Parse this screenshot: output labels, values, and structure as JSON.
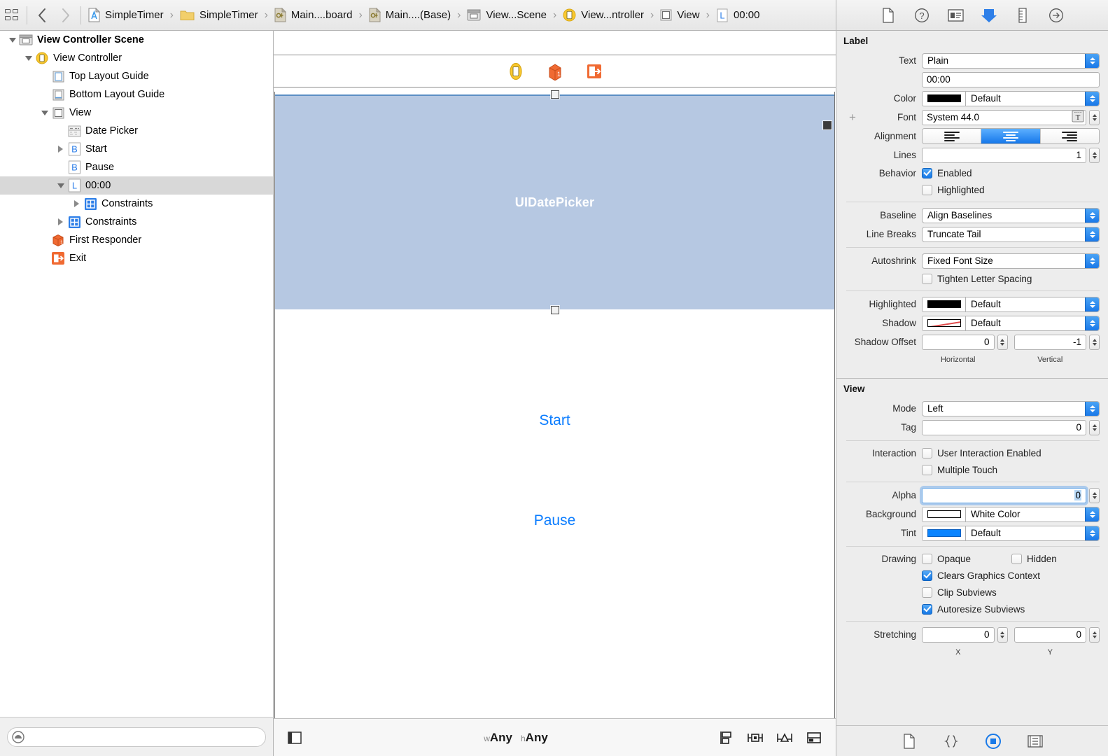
{
  "jumpbar": {
    "nav_back": "‹",
    "nav_forward": "›",
    "breadcrumbs": [
      {
        "label": "SimpleTimer",
        "icon": "project-icon"
      },
      {
        "label": "SimpleTimer",
        "icon": "folder-icon"
      },
      {
        "label": "Main....board",
        "icon": "storyboard-file-icon"
      },
      {
        "label": "Main....(Base)",
        "icon": "storyboard-file-icon"
      },
      {
        "label": "View...Scene",
        "icon": "scene-icon"
      },
      {
        "label": "View...ntroller",
        "icon": "view-controller-icon"
      },
      {
        "label": "View",
        "icon": "view-icon"
      },
      {
        "label": "00:00",
        "icon": "label-icon"
      }
    ],
    "separator": "›"
  },
  "inspector_toolbar": {
    "tabs": [
      {
        "name": "file-inspector",
        "icon": "document-icon",
        "selected": false
      },
      {
        "name": "quick-help-inspector",
        "icon": "question-circle-icon",
        "selected": false
      },
      {
        "name": "identity-inspector",
        "icon": "id-card-icon",
        "selected": false
      },
      {
        "name": "attributes-inspector",
        "icon": "down-arrow-shield-icon",
        "selected": true
      },
      {
        "name": "size-inspector",
        "icon": "ruler-icon",
        "selected": false
      },
      {
        "name": "connections-inspector",
        "icon": "arrow-right-circle-icon",
        "selected": false
      }
    ],
    "selected_color": "#2e7fe8"
  },
  "outline": {
    "rows": [
      {
        "label": "View Controller Scene",
        "indent": 0,
        "twisty": "down",
        "icon": "scene-icon",
        "bold": true,
        "selected": false
      },
      {
        "label": "View Controller",
        "indent": 1,
        "twisty": "down",
        "icon": "view-controller-icon",
        "bold": false,
        "selected": false
      },
      {
        "label": "Top Layout Guide",
        "indent": 2,
        "twisty": "none",
        "icon": "top-layout-guide-icon",
        "bold": false,
        "selected": false
      },
      {
        "label": "Bottom Layout Guide",
        "indent": 2,
        "twisty": "none",
        "icon": "bottom-layout-guide-icon",
        "bold": false,
        "selected": false
      },
      {
        "label": "View",
        "indent": 2,
        "twisty": "down",
        "icon": "view-icon",
        "bold": false,
        "selected": false
      },
      {
        "label": "Date Picker",
        "indent": 3,
        "twisty": "none",
        "icon": "date-picker-icon",
        "bold": false,
        "selected": false
      },
      {
        "label": "Start",
        "indent": 3,
        "twisty": "right",
        "icon": "button-icon",
        "bold": false,
        "selected": false
      },
      {
        "label": "Pause",
        "indent": 3,
        "twisty": "none",
        "icon": "button-icon",
        "bold": false,
        "selected": false
      },
      {
        "label": "00:00",
        "indent": 3,
        "twisty": "down",
        "icon": "label-icon",
        "bold": false,
        "selected": true
      },
      {
        "label": "Constraints",
        "indent": 4,
        "twisty": "right",
        "icon": "constraints-icon",
        "bold": false,
        "selected": false
      },
      {
        "label": "Constraints",
        "indent": 3,
        "twisty": "right",
        "icon": "constraints-icon",
        "bold": false,
        "selected": false
      },
      {
        "label": "First Responder",
        "indent": 2,
        "twisty": "none",
        "icon": "first-responder-icon",
        "bold": false,
        "selected": false
      },
      {
        "label": "Exit",
        "indent": 2,
        "twisty": "none",
        "icon": "exit-icon",
        "bold": false,
        "selected": false
      }
    ],
    "filter_placeholder": ""
  },
  "canvas": {
    "scene_dock": [
      {
        "name": "view-controller-dock-icon"
      },
      {
        "name": "first-responder-dock-icon"
      },
      {
        "name": "exit-dock-icon"
      }
    ],
    "date_picker_label": "UIDatePicker",
    "date_picker_bg": "#b6c8e2",
    "start_button": "Start",
    "pause_button": "Pause",
    "button_color": "#0a7cff",
    "size_class_width": "Any",
    "size_class_height": "Any",
    "size_class_width_prefix": "w",
    "size_class_height_prefix": "h",
    "autolayout_buttons": [
      {
        "name": "stack-button",
        "icon": "stack-icon"
      },
      {
        "name": "align-button",
        "icon": "align-icon"
      },
      {
        "name": "pin-button",
        "icon": "pin-icon"
      },
      {
        "name": "resolve-button",
        "icon": "resolve-autolayout-icon"
      }
    ]
  },
  "inspector": {
    "label_section": {
      "title": "Label",
      "text_label": "Text",
      "text_type": "Plain",
      "text_value": "00:00",
      "color_label": "Color",
      "color_value": "Default",
      "color_swatch": "#000000",
      "font_label": "Font",
      "font_value": "System 44.0",
      "alignment_label": "Alignment",
      "alignment_options": [
        "left",
        "center",
        "right"
      ],
      "alignment_selected": "center",
      "lines_label": "Lines",
      "lines_value": "1",
      "behavior_label": "Behavior",
      "behavior_enabled_label": "Enabled",
      "behavior_enabled": true,
      "behavior_highlighted_label": "Highlighted",
      "behavior_highlighted": false,
      "baseline_label": "Baseline",
      "baseline_value": "Align Baselines",
      "linebreaks_label": "Line Breaks",
      "linebreaks_value": "Truncate Tail",
      "autoshrink_label": "Autoshrink",
      "autoshrink_value": "Fixed Font Size",
      "tighten_label": "Tighten Letter Spacing",
      "tighten_checked": false,
      "highlighted_label": "Highlighted",
      "highlighted_value": "Default",
      "highlighted_swatch": "#000000",
      "shadow_label": "Shadow",
      "shadow_value": "Default",
      "shadow_offset_label": "Shadow Offset",
      "shadow_offset_h": "0",
      "shadow_offset_v": "-1",
      "shadow_offset_h_sub": "Horizontal",
      "shadow_offset_v_sub": "Vertical"
    },
    "view_section": {
      "title": "View",
      "mode_label": "Mode",
      "mode_value": "Left",
      "tag_label": "Tag",
      "tag_value": "0",
      "interaction_label": "Interaction",
      "user_interaction_label": "User Interaction Enabled",
      "user_interaction_checked": false,
      "multiple_touch_label": "Multiple Touch",
      "multiple_touch_checked": false,
      "alpha_label": "Alpha",
      "alpha_value": "0",
      "alpha_focused": true,
      "background_label": "Background",
      "background_value": "White Color",
      "background_swatch": "#ffffff",
      "tint_label": "Tint",
      "tint_value": "Default",
      "tint_swatch": "#0a84ff",
      "drawing_label": "Drawing",
      "opaque_label": "Opaque",
      "opaque_checked": false,
      "hidden_label": "Hidden",
      "hidden_checked": false,
      "clears_graphics_label": "Clears Graphics Context",
      "clears_graphics_checked": true,
      "clip_subviews_label": "Clip Subviews",
      "clip_subviews_checked": false,
      "autoresize_subviews_label": "Autoresize Subviews",
      "autoresize_subviews_checked": true,
      "stretching_label": "Stretching",
      "stretching_x": "0",
      "stretching_y": "0",
      "stretching_x_sub": "X",
      "stretching_y_sub": "Y"
    }
  },
  "library_bar": {
    "tabs": [
      {
        "name": "file-template-library",
        "icon": "document-icon",
        "selected": false
      },
      {
        "name": "code-snippet-library",
        "icon": "braces-icon",
        "selected": false
      },
      {
        "name": "object-library",
        "icon": "object-circle-icon",
        "selected": true
      },
      {
        "name": "media-library",
        "icon": "media-icon",
        "selected": false
      }
    ],
    "selected_color": "#1a7ae8"
  }
}
